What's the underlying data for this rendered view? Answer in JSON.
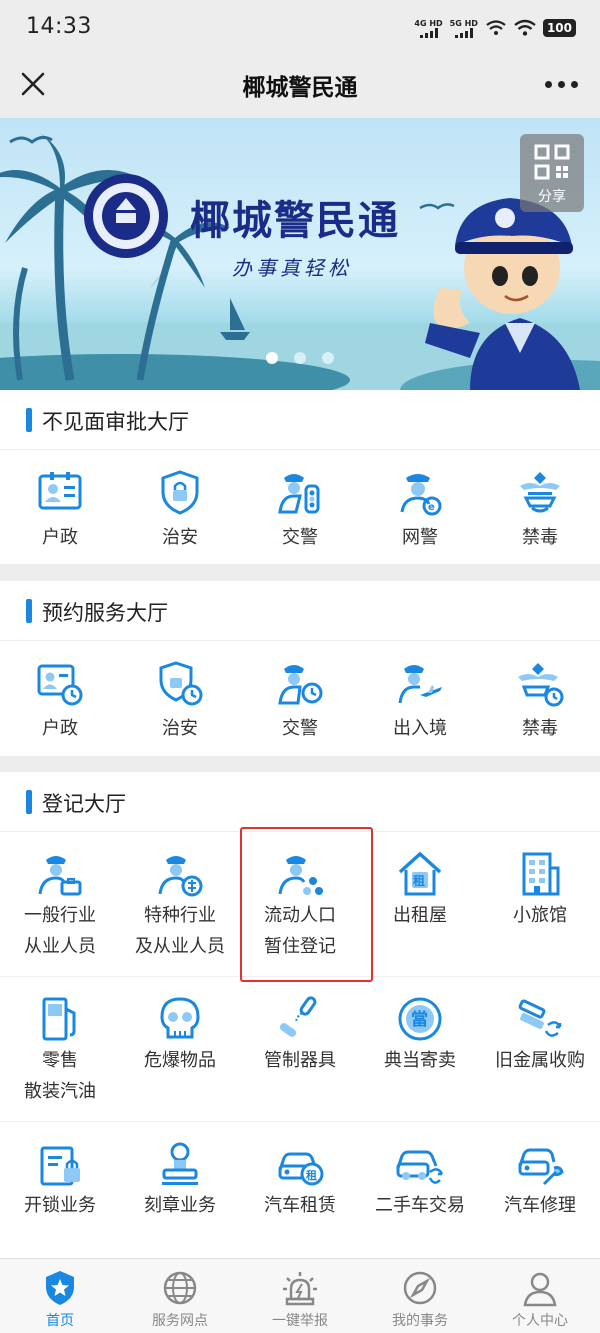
{
  "status": {
    "time": "14:33",
    "net1": "4G HD",
    "net2": "5G HD",
    "battery": "100"
  },
  "header": {
    "title": "椰城警民通"
  },
  "banner": {
    "title": "椰城警民通",
    "subtitle": "办事真轻松",
    "share_label": "分享"
  },
  "sections": [
    {
      "title": "不见面审批大厅",
      "items": [
        {
          "label": "户政",
          "icon": "id-card-icon"
        },
        {
          "label": "治安",
          "icon": "shield-icon"
        },
        {
          "label": "交警",
          "icon": "traffic-police-icon"
        },
        {
          "label": "网警",
          "icon": "cyber-police-icon"
        },
        {
          "label": "禁毒",
          "icon": "anti-drug-icon"
        }
      ]
    },
    {
      "title": "预约服务大厅",
      "items": [
        {
          "label": "户政",
          "icon": "id-card-clock-icon"
        },
        {
          "label": "治安",
          "icon": "shield-clock-icon"
        },
        {
          "label": "交警",
          "icon": "traffic-police-clock-icon"
        },
        {
          "label": "出入境",
          "icon": "immigration-icon"
        },
        {
          "label": "禁毒",
          "icon": "anti-drug-clock-icon"
        }
      ]
    },
    {
      "title": "登记大厅",
      "rows": [
        [
          {
            "line1": "一般行业",
            "line2": "从业人员",
            "icon": "worker-briefcase-icon"
          },
          {
            "line1": "特种行业",
            "line2": "及从业人员",
            "icon": "special-worker-icon"
          },
          {
            "line1": "流动人口",
            "line2": "暂住登记",
            "icon": "floating-population-icon"
          },
          {
            "line1": "出租屋",
            "line2": "",
            "icon": "rental-house-icon"
          },
          {
            "line1": "小旅馆",
            "line2": "",
            "icon": "hotel-icon"
          }
        ],
        [
          {
            "line1": "零售",
            "line2": "散装汽油",
            "icon": "gas-pump-icon"
          },
          {
            "line1": "危爆物品",
            "line2": "",
            "icon": "skull-icon"
          },
          {
            "line1": "管制器具",
            "line2": "",
            "icon": "nunchaku-icon"
          },
          {
            "line1": "典当寄卖",
            "line2": "",
            "icon": "pawn-icon"
          },
          {
            "line1": "旧金属收购",
            "line2": "",
            "icon": "scrap-metal-icon"
          }
        ],
        [
          {
            "line1": "开锁业务",
            "line2": "",
            "icon": "lock-icon"
          },
          {
            "line1": "刻章业务",
            "line2": "",
            "icon": "stamp-icon"
          },
          {
            "line1": "汽车租赁",
            "line2": "",
            "icon": "car-rental-icon"
          },
          {
            "line1": "二手车交易",
            "line2": "",
            "icon": "used-car-icon"
          },
          {
            "line1": "汽车修理",
            "line2": "",
            "icon": "car-repair-icon"
          }
        ]
      ]
    }
  ],
  "bottom_nav": [
    {
      "label": "首页",
      "icon": "home-star-icon",
      "active": true
    },
    {
      "label": "服务网点",
      "icon": "globe-icon",
      "active": false
    },
    {
      "label": "一键举报",
      "icon": "alarm-icon",
      "active": false
    },
    {
      "label": "我的事务",
      "icon": "compass-icon",
      "active": false
    },
    {
      "label": "个人中心",
      "icon": "person-icon",
      "active": false
    }
  ],
  "colors": {
    "accent": "#1a88e0",
    "icon_light": "#8ec9f5",
    "highlight": "#e3322b"
  }
}
